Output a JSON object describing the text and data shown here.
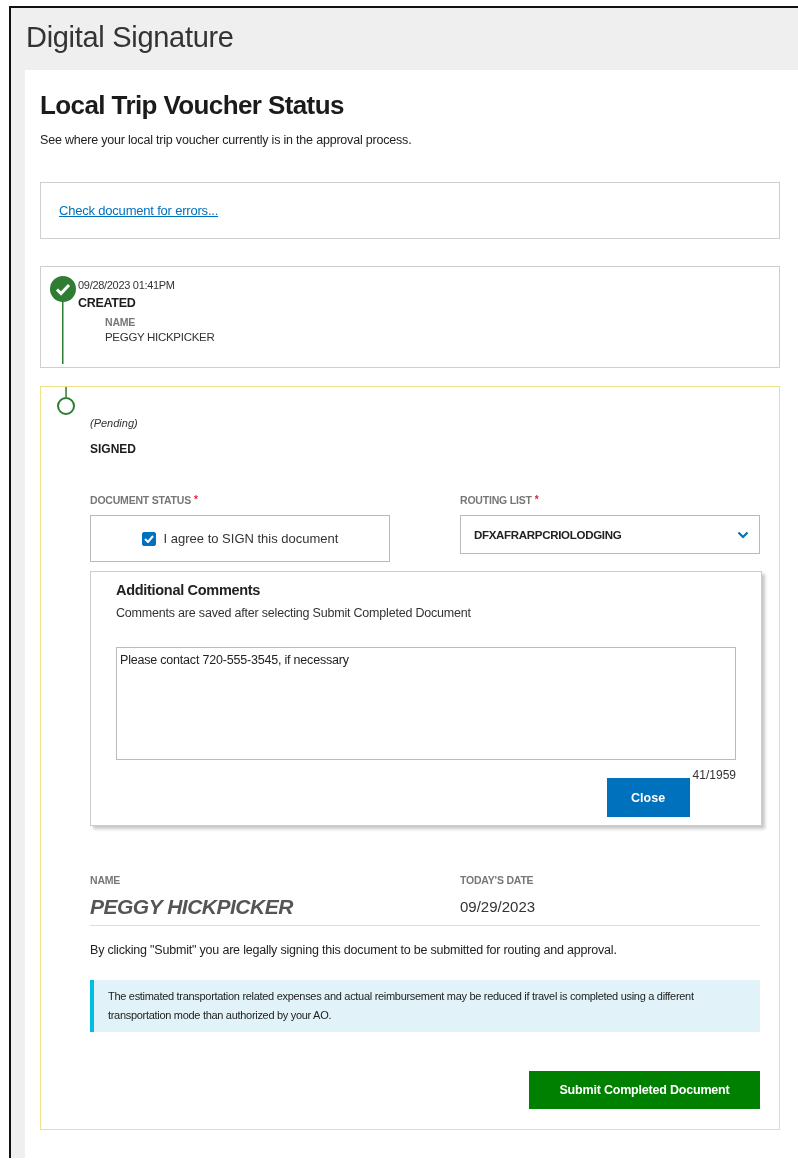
{
  "header": {
    "title": "Digital Signature"
  },
  "page": {
    "title": "Local Trip Voucher Status",
    "subtitle": "See where your local trip voucher currently is in the approval process."
  },
  "error_check": {
    "link": "Check document for errors..."
  },
  "steps": [
    {
      "kind": "completed",
      "timestamp": "09/28/2023 01:41PM",
      "status": "CREATED",
      "name_label": "NAME",
      "name": "PEGGY HICKPICKER"
    },
    {
      "kind": "pending",
      "note": "(Pending)",
      "status": "SIGNED"
    }
  ],
  "signing_form": {
    "document_status": {
      "label": "DOCUMENT STATUS",
      "required_mark": "*",
      "checkbox": {
        "label": "I agree to SIGN this document",
        "checked": true
      }
    },
    "routing_list": {
      "label": "ROUTING LIST",
      "required_mark": "*",
      "value": "DFXAFRARPCRIOLODGING"
    },
    "comments": {
      "title": "Additional Comments",
      "hint": "Comments are saved after selecting Submit Completed Document",
      "value": "Please contact 720-555-3545, if necessary",
      "counter": "41/1959",
      "close_button": "Close"
    },
    "name_label": "NAME",
    "name": "PEGGY HICKPICKER",
    "date_label": "TODAY'S DATE",
    "date": "09/29/2023",
    "legal_notice": "By clicking \"Submit\" you are legally signing this document to be submitted for routing and approval.",
    "info_message": "The estimated transportation related expenses and actual reimbursement may be reduced if travel is completed using a different transportation mode than authorized by your AO.",
    "submit_button": "Submit Completed Document"
  }
}
